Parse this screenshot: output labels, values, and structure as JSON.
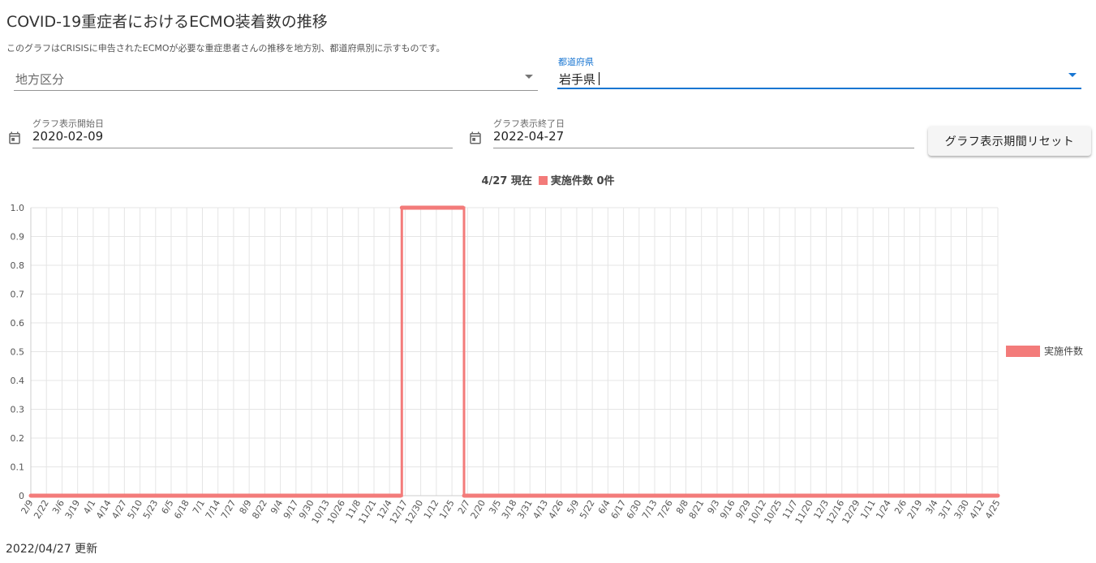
{
  "header": {
    "title": "COVID-19重症者におけるECMO装着数の推移",
    "subtitle": "このグラフはCRISISに申告されたECMOが必要な重症患者さんの推移を地方別、都道府県別に示すものです。"
  },
  "filters": {
    "region_placeholder": "地方区分",
    "prefecture_label": "都道府県",
    "prefecture_value": "岩手県"
  },
  "dates": {
    "start_label": "グラフ表示開始日",
    "start_value": "2020-02-09",
    "end_label": "グラフ表示終了日",
    "end_value": "2022-04-27"
  },
  "reset_button_label": "グラフ表示期間リセット",
  "summary": {
    "date_prefix": "4/27 現在",
    "text": "実施件数 0件"
  },
  "colors": {
    "series": "#f37b7a",
    "accent": "#1976d2"
  },
  "chart_data": {
    "type": "line",
    "title": "",
    "xlabel": "",
    "ylabel": "",
    "ylim": [
      0,
      1
    ],
    "y_ticks": [
      "1.0",
      "0.9",
      "0.8",
      "0.7",
      "0.6",
      "0.5",
      "0.4",
      "0.3",
      "0.2",
      "0.1",
      "0"
    ],
    "grid": true,
    "legend_position": "right",
    "x_tick_labels": [
      "2/9",
      "2/22",
      "3/6",
      "3/19",
      "4/1",
      "4/14",
      "4/27",
      "5/10",
      "5/23",
      "6/5",
      "6/18",
      "7/1",
      "7/14",
      "7/27",
      "8/9",
      "8/22",
      "9/4",
      "9/17",
      "9/30",
      "10/13",
      "10/26",
      "11/8",
      "11/21",
      "12/4",
      "12/17",
      "12/30",
      "1/12",
      "1/25",
      "2/7",
      "2/20",
      "3/5",
      "3/18",
      "3/31",
      "4/13",
      "4/26",
      "5/9",
      "5/22",
      "6/4",
      "6/17",
      "6/30",
      "7/13",
      "7/26",
      "8/8",
      "8/21",
      "9/3",
      "9/16",
      "9/29",
      "10/12",
      "10/25",
      "11/7",
      "11/20",
      "12/3",
      "12/16",
      "12/29",
      "1/11",
      "1/24",
      "2/6",
      "2/19",
      "3/4",
      "3/17",
      "3/30",
      "4/12",
      "4/25"
    ],
    "series": [
      {
        "name": "実施件数",
        "x_range": [
          "2020-02-09",
          "2022-04-27"
        ],
        "segments": [
          {
            "from": "2020-02-09",
            "to": "2020-12-14",
            "value": 0
          },
          {
            "from": "2020-12-15",
            "to": "2021-02-04",
            "value": 1
          },
          {
            "from": "2021-02-05",
            "to": "2022-04-27",
            "value": 0
          }
        ]
      }
    ]
  },
  "footer": {
    "updated": "2022/04/27 更新"
  }
}
